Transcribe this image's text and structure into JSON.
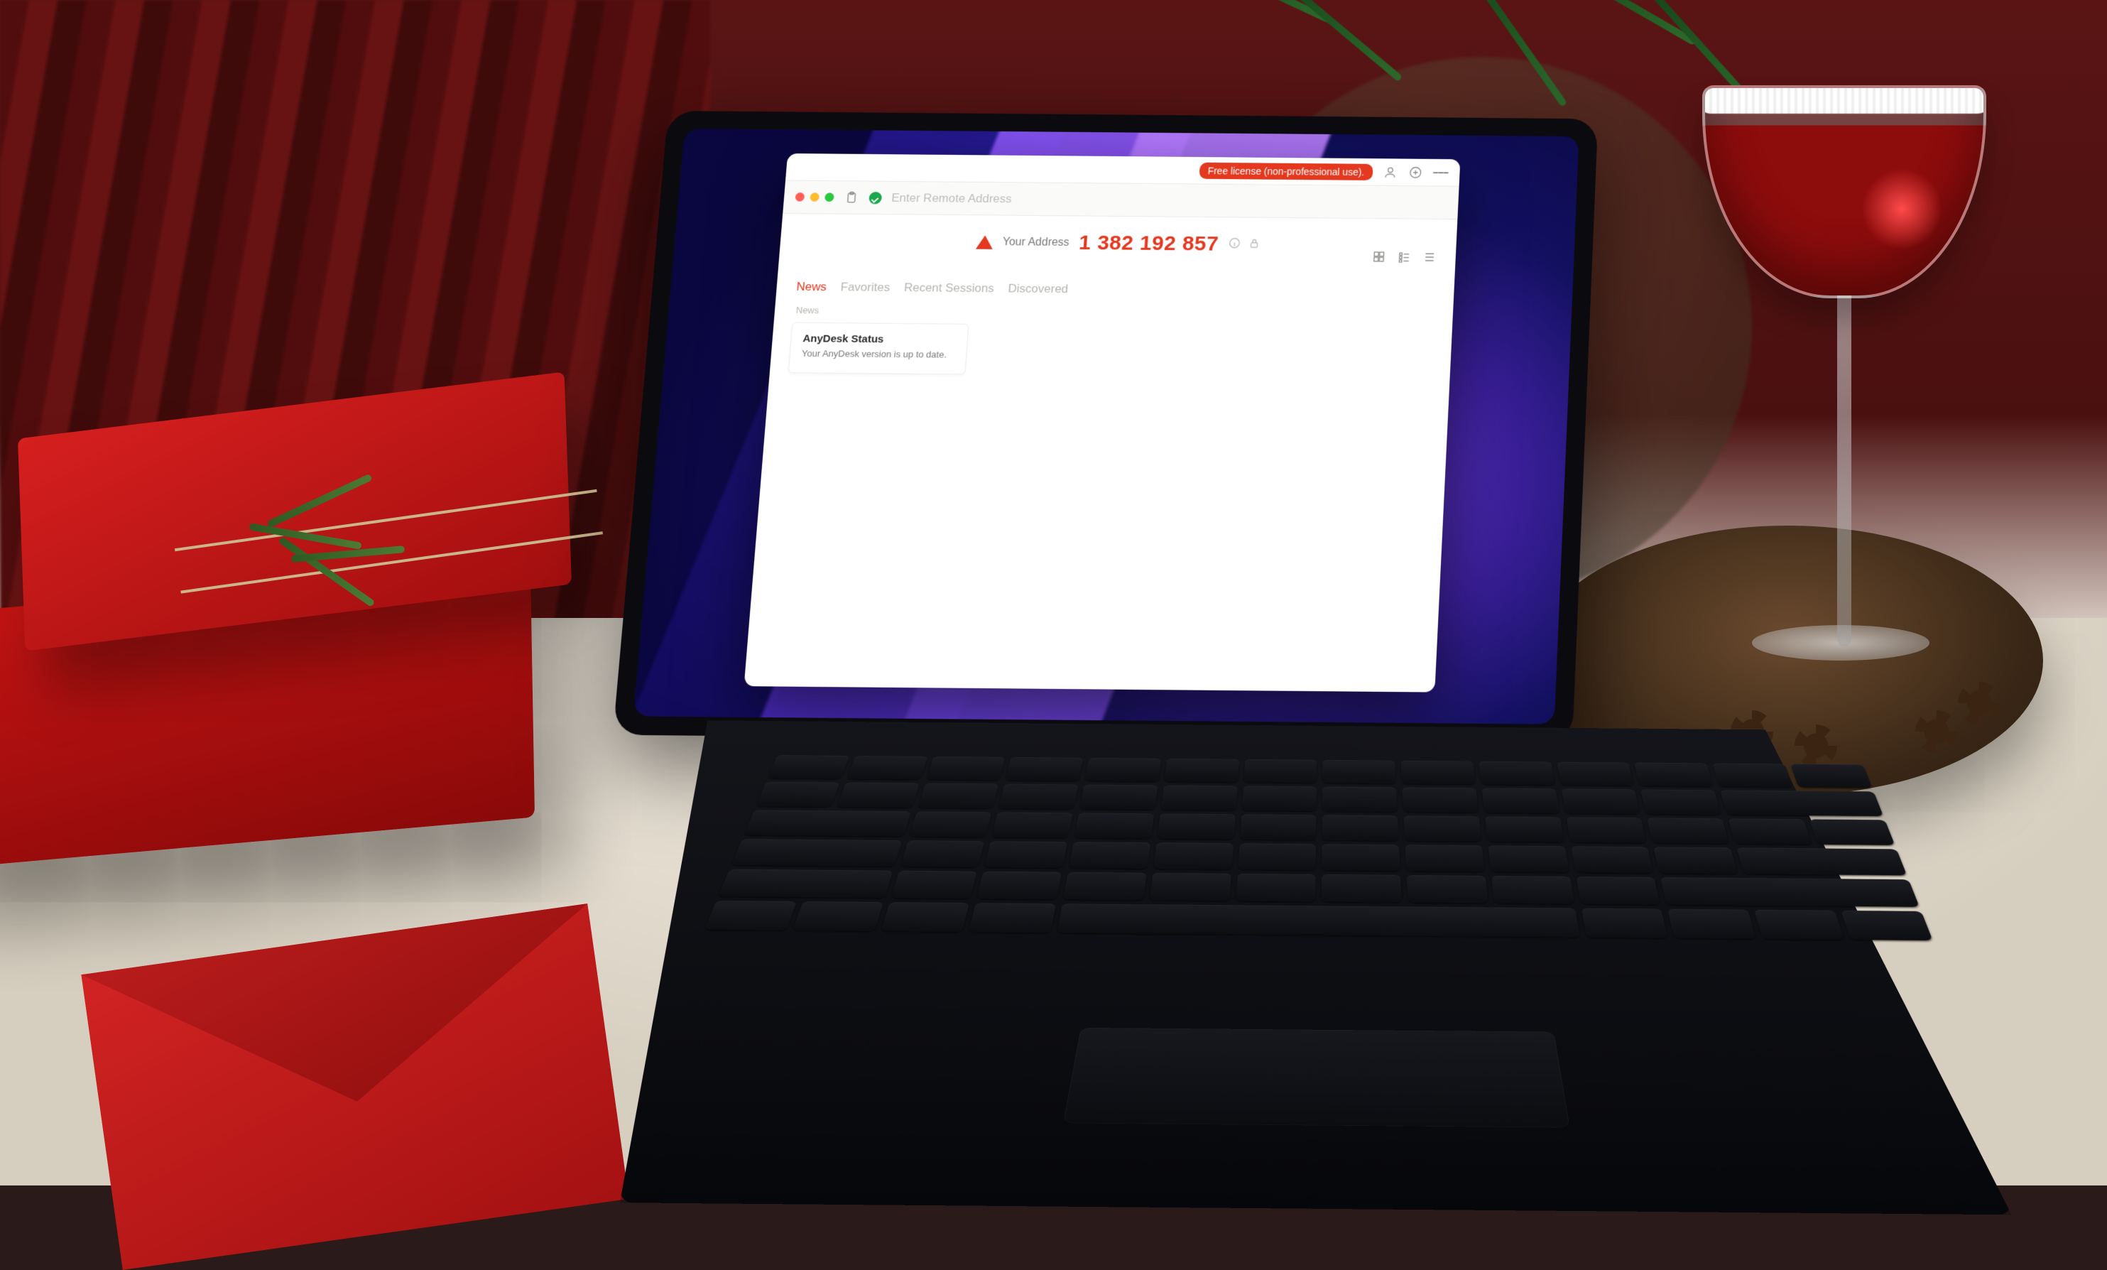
{
  "topbar": {
    "license_text": "Free license (non-professional use)."
  },
  "toolbar": {
    "address_placeholder": "Enter Remote Address"
  },
  "your_address": {
    "label": "Your Address",
    "id": "1 382 192 857"
  },
  "tabs": [
    {
      "label": "News",
      "active": true
    },
    {
      "label": "Favorites",
      "active": false
    },
    {
      "label": "Recent Sessions",
      "active": false
    },
    {
      "label": "Discovered",
      "active": false
    }
  ],
  "section_heading": "News",
  "news_card": {
    "title": "AnyDesk Status",
    "body": "Your AnyDesk version is up to date."
  }
}
